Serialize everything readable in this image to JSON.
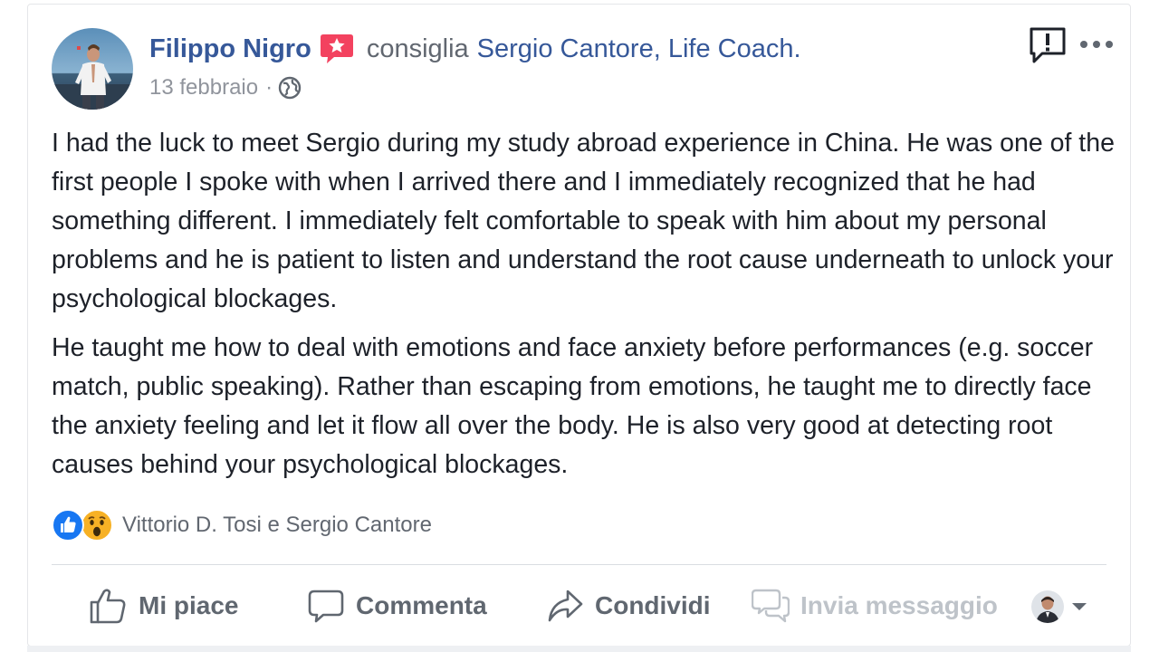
{
  "post": {
    "author": "Filippo Nigro",
    "verb": "consiglia",
    "page_name": "Sergio Cantore, Life Coach.",
    "date": "13 febbraio",
    "separator": "·",
    "privacy_icon": "globe-icon",
    "badge_icon": "recommendation-star-icon",
    "paragraphs": [
      "I had the luck to meet Sergio during my study abroad experience in China. He was one of the first people I spoke with when I arrived there and I immediately recognized that he had something different. I immediately felt comfortable to speak with him about my personal problems and he is patient to listen and understand the root cause underneath to unlock your psychological blockages.",
      "He taught me how to deal with emotions and face anxiety before performances (e.g. soccer match, public speaking). Rather than escaping from emotions, he taught me to directly face the anxiety feeling and let it flow all over the body. He is also very good at detecting root causes behind your psychological blockages."
    ]
  },
  "reactions": {
    "icons": [
      "like-reaction-icon",
      "wow-reaction-icon"
    ],
    "names": "Vittorio D. Tosi e Sergio Cantore"
  },
  "actions": {
    "like": "Mi piace",
    "comment": "Commenta",
    "share": "Condividi",
    "message": "Invia messaggio"
  },
  "colors": {
    "link": "#365899",
    "text": "#1d2129",
    "secondary": "#616770",
    "meta": "#90949c",
    "badge": "#f3425f",
    "like_blue": "#1877f2",
    "wow_yellow": "#f7b125",
    "divider": "#dadde1"
  }
}
